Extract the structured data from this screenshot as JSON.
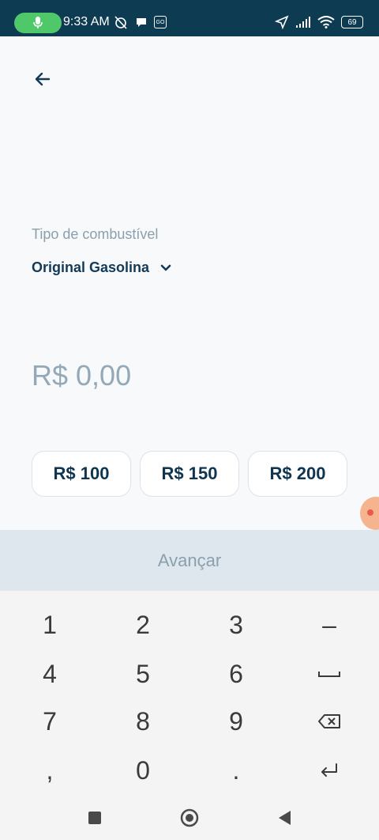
{
  "status_bar": {
    "time": "9:33 AM",
    "battery": "69",
    "go_badge": "GO"
  },
  "fuel": {
    "label": "Tipo de combustível",
    "value": "Original Gasolina"
  },
  "amount": "R$ 0,00",
  "quick_amounts": [
    "R$ 100",
    "R$ 150",
    "R$ 200"
  ],
  "next_button": "Avançar",
  "keyboard": {
    "keys": [
      "1",
      "2",
      "3",
      "–",
      "4",
      "5",
      "6",
      "9",
      "7",
      "8",
      ",",
      "0",
      "."
    ]
  },
  "colors": {
    "status_bar": "#0d3b52",
    "accent_text": "#143a57",
    "muted_text": "#8aa0ac",
    "next_bar": "#dee6ee"
  }
}
